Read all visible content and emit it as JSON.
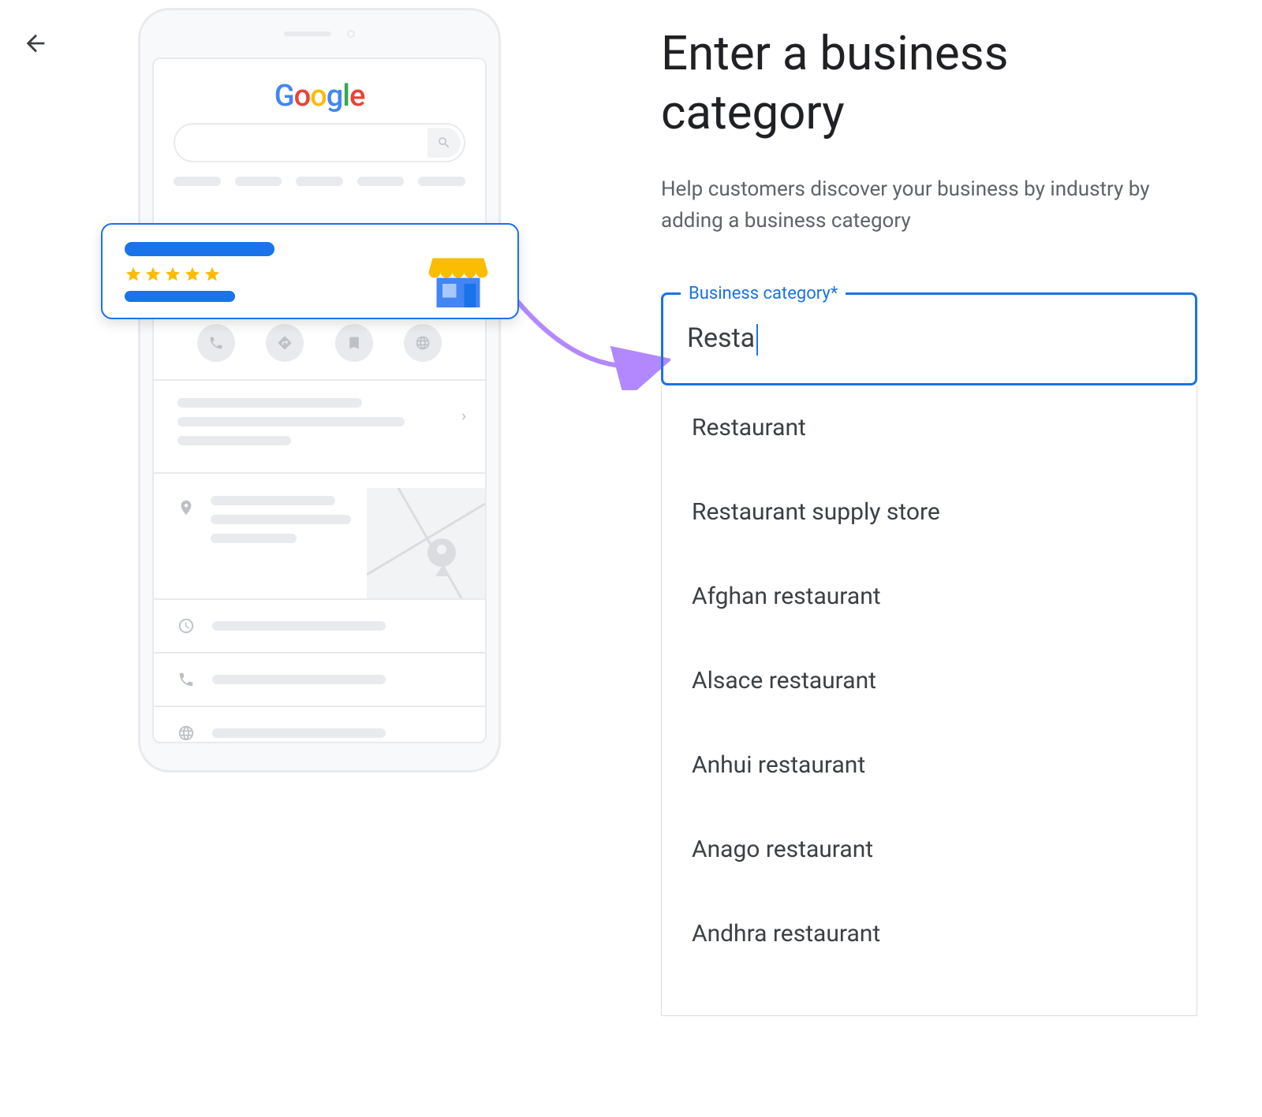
{
  "back_icon": "back",
  "phone": {
    "logo_letters": [
      "G",
      "o",
      "o",
      "g",
      "l",
      "e"
    ]
  },
  "right": {
    "title": "Enter a business category",
    "subtitle": "Help customers discover your business by industry by adding a business category",
    "input_label": "Business category*",
    "input_value": "Resta",
    "options": [
      "Restaurant",
      "Restaurant supply store",
      "Afghan restaurant",
      "Alsace restaurant",
      "Anhui restaurant",
      "Anago restaurant",
      "Andhra restaurant"
    ]
  }
}
